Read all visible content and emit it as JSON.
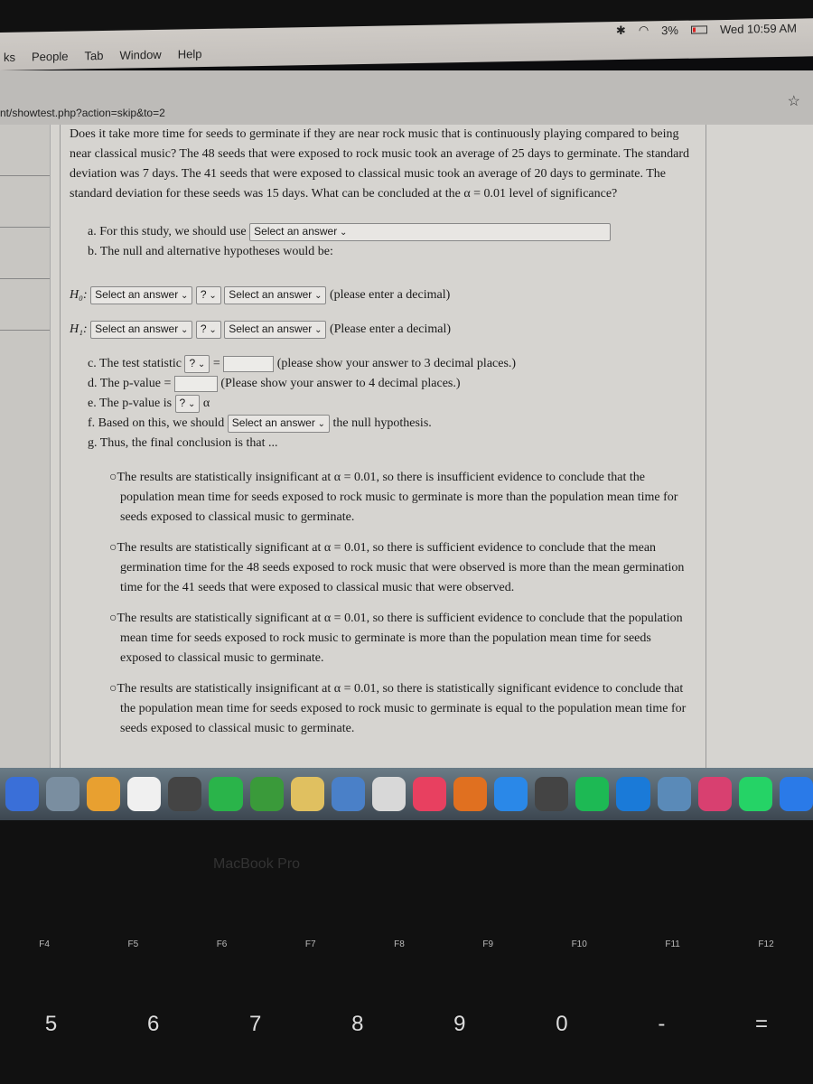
{
  "menubar": {
    "items": [
      "ks",
      "People",
      "Tab",
      "Window",
      "Help"
    ],
    "battery": "3%",
    "clock": "Wed 10:59 AM"
  },
  "browser": {
    "url": "nt/showtest.php?action=skip&to=2"
  },
  "question": {
    "text": "Does it take more time for seeds to germinate if they are near rock music that is continuously playing compared to being near classical music? The 48 seeds that were exposed to rock music took an average of 25 days to germinate. The standard deviation was 7 days. The 41 seeds that were exposed to classical music took an average of 20 days to germinate. The standard deviation for these seeds was 15 days. What can be concluded at the α = 0.01 level of significance?",
    "a_label": "a. For this study, we should use",
    "a_select": "Select an answer",
    "b_label": "b. The null and alternative hypotheses would be:",
    "h0": {
      "label": "H₀:",
      "sel1": "Select an answer",
      "op": "?",
      "sel2": "Select an answer",
      "note": "(please enter a decimal)"
    },
    "h1": {
      "label": "H₁:",
      "sel1": "Select an answer",
      "op": "?",
      "sel2": "Select an answer",
      "note": "(Please enter a decimal)"
    },
    "c_label": "c. The test statistic",
    "c_op": "?",
    "c_eq": "=",
    "c_note": "(please show your answer to 3 decimal places.)",
    "d_label": "d. The p-value =",
    "d_note": "(Please show your answer to 4 decimal places.)",
    "e_label": "e. The p-value is",
    "e_op": "?",
    "e_alpha": "α",
    "f_label": "f. Based on this, we should",
    "f_select": "Select an answer",
    "f_after": "the null hypothesis.",
    "g_label": "g. Thus, the final conclusion is that ...",
    "options": [
      "The results are statistically insignificant at α = 0.01, so there is insufficient evidence to conclude that the population mean time for seeds exposed to rock music to germinate is more than the population mean time for seeds exposed to classical music to germinate.",
      "The results are statistically significant at α = 0.01, so there is sufficient evidence to conclude that the mean germination time for the 48 seeds exposed to rock music that were observed is more than the mean germination time for the 41 seeds that were exposed to classical music that were observed.",
      "The results are statistically significant at α = 0.01, so there is sufficient evidence to conclude that the population mean time for seeds exposed to rock music to germinate is more than the population mean time for seeds exposed to classical music to germinate.",
      "The results are statistically insignificant at α = 0.01, so there is statistically significant evidence to conclude that the population mean time for seeds exposed to rock music to germinate is equal to the population mean time for seeds exposed to classical music to germinate."
    ]
  },
  "dock": {
    "colors": [
      "#3a6fd8",
      "#7a8ea0",
      "#e8a030",
      "#f0f0f0",
      "#444",
      "#2ab44a",
      "#3a9a3a",
      "#e0c060",
      "#4a80c8",
      "#d8d8d8",
      "#e84060",
      "#e07020",
      "#2a88e8",
      "#444",
      "#1db954",
      "#1a7ad8",
      "#5a8ab8",
      "#d84070",
      "#25d366",
      "#2a7ae8"
    ]
  },
  "keyboard": {
    "brand": "MacBook Pro",
    "fkeys": [
      "F4",
      "F5",
      "F6",
      "F7",
      "F8",
      "F9",
      "F10",
      "F11",
      "F12"
    ],
    "numkeys": [
      "5",
      "6",
      "7",
      "8",
      "9",
      "0",
      "-",
      "="
    ]
  }
}
